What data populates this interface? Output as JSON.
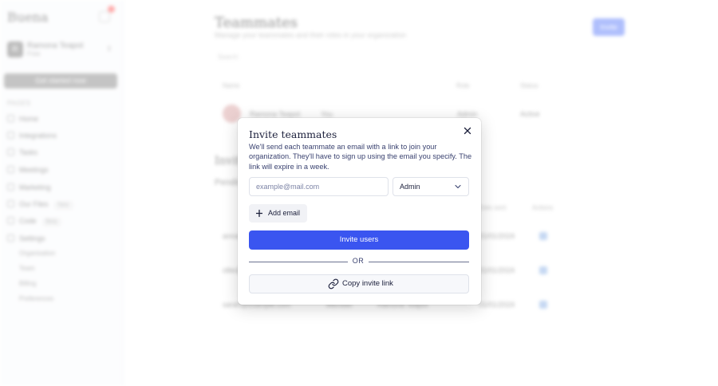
{
  "sidebar": {
    "logo": "Buena",
    "org_name": "Ramona Teapot",
    "org_plan": "Free",
    "org_initial": "R",
    "action_button": "Get started now",
    "section_label": "PAGES",
    "items": [
      {
        "label": "Home"
      },
      {
        "label": "Integrations"
      },
      {
        "label": "Tasks"
      },
      {
        "label": "Meetings"
      },
      {
        "label": "Marketing"
      },
      {
        "label": "Our Files",
        "tag": "New"
      },
      {
        "label": "Code",
        "tag": "Beta"
      },
      {
        "label": "Settings"
      }
    ],
    "sub_items": [
      {
        "label": "Organisation"
      },
      {
        "label": "Team"
      },
      {
        "label": "Billing"
      },
      {
        "label": "Preferences"
      }
    ]
  },
  "main": {
    "title": "Teammates",
    "subtitle": "Manage your teammates and their roles in your organization",
    "invite_button": "Invite",
    "search_placeholder": "Search",
    "table_headers": {
      "name": "Name",
      "role": "Role",
      "status": "Status"
    },
    "member": {
      "name": "Ramona Teapot",
      "badge": "You",
      "role": "Admin",
      "status": "Active"
    },
    "pending_title": "Invitations",
    "pending_subtitle": "Pending invitations",
    "pending_headers": {
      "date": "Date sent",
      "actions": "Actions"
    },
    "pending_rows": [
      {
        "email": "anna@",
        "date": "01/01/2024"
      },
      {
        "email": "ollie@",
        "date": "01/01/2024"
      },
      {
        "email": "sarah@example.com",
        "role": "Member",
        "sent_by": "Ramona Teapot",
        "date": "01/01/2024"
      }
    ]
  },
  "modal": {
    "title": "Invite teammates",
    "description": "We'll send each teammate an email with a link to join your organization. They'll have to sign up using the email you specify. The link will expire in a week.",
    "email_placeholder": "example@mail.com",
    "role_value": "Admin",
    "add_email_label": "Add email",
    "invite_label": "Invite users",
    "or_label": "OR",
    "copy_link_label": "Copy invite link"
  },
  "colors": {
    "primary": "#3a55f0",
    "text": "#1b1f3b",
    "muted": "#3a4270"
  },
  "icons": {
    "close": "close-icon",
    "chevron": "chevron-down-icon",
    "plus": "plus-icon",
    "link": "link-icon"
  }
}
